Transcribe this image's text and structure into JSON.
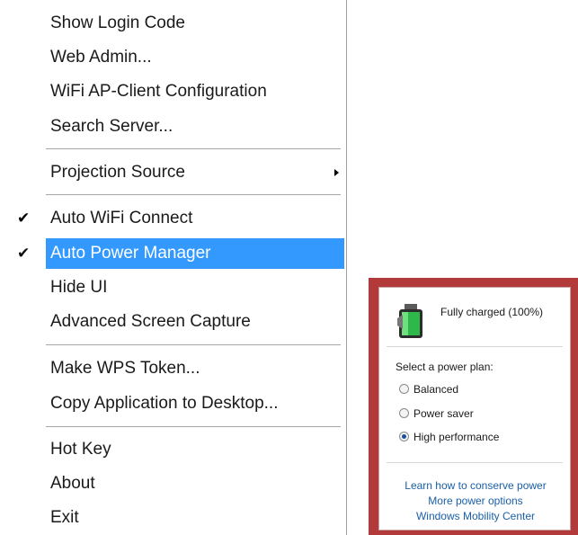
{
  "menu": {
    "items": [
      {
        "label": "Show Login Code"
      },
      {
        "label": "Web Admin..."
      },
      {
        "label": "WiFi AP-Client Configuration"
      },
      {
        "label": "Search Server..."
      },
      {
        "label": "Projection Source"
      },
      {
        "label": "Auto WiFi Connect",
        "checked": true
      },
      {
        "label": "Auto Power Manager",
        "checked": true,
        "highlighted": true
      },
      {
        "label": "Hide UI"
      },
      {
        "label": "Advanced Screen Capture"
      },
      {
        "label": "Make WPS Token..."
      },
      {
        "label": "Copy Application to Desktop..."
      },
      {
        "label": "Hot Key"
      },
      {
        "label": "About"
      },
      {
        "label": "Exit"
      }
    ],
    "check_glyph": "✔",
    "highlight_color": "#3399ff"
  },
  "power": {
    "status": "Fully charged (100%)",
    "plan_title": "Select a power plan:",
    "plans": [
      {
        "label": "Balanced",
        "selected": false
      },
      {
        "label": "Power saver",
        "selected": false
      },
      {
        "label": "High performance",
        "selected": true
      }
    ],
    "links": [
      "Learn how to conserve power",
      "More power options",
      "Windows Mobility Center"
    ],
    "frame_color": "#b33a3a",
    "battery_icon": "battery-full-icon"
  }
}
